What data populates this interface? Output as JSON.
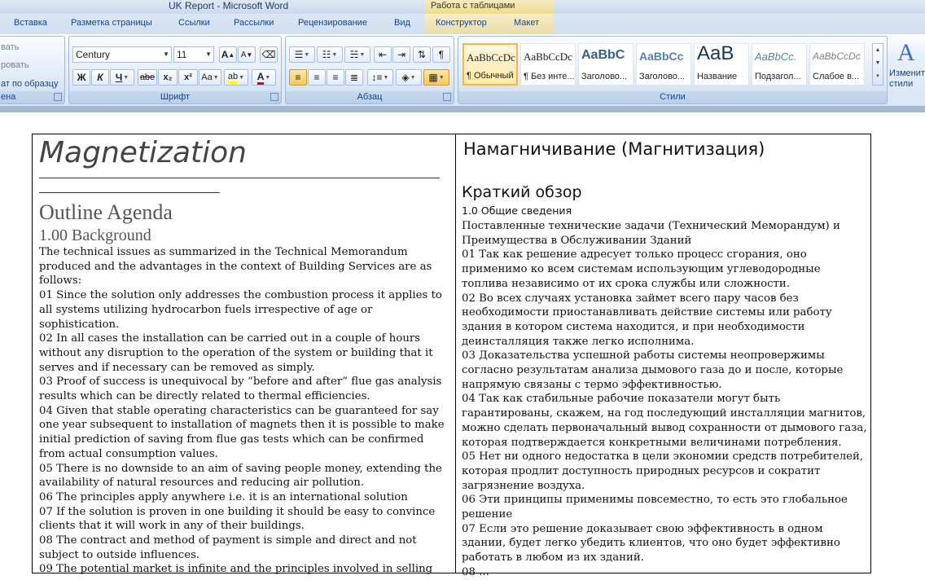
{
  "window": {
    "title": "UK Report - Microsoft Word",
    "context_tab_group": "Работа с таблицами"
  },
  "tabs": [
    "Вставка",
    "Разметка страницы",
    "Ссылки",
    "Рассылки",
    "Рецензирование",
    "Вид",
    "Конструктор",
    "Макет"
  ],
  "clipboard": {
    "cut": "вать",
    "copy": "ровать",
    "format_painter": "ат по образцу",
    "label": "ена"
  },
  "font": {
    "name": "Century",
    "size": "11",
    "group_label": "Шрифт",
    "bold": "Ж",
    "italic": "К",
    "underline": "Ч",
    "strike": "abe",
    "subscript": "x₂",
    "superscript": "x²",
    "change_case": "Aa",
    "grow": "A",
    "shrink": "A"
  },
  "paragraph": {
    "group_label": "Абзац"
  },
  "styles": {
    "group_label": "Стили",
    "items": [
      {
        "sample": "AaBbCcDc",
        "name": "¶ Обычный",
        "selected": true
      },
      {
        "sample": "AaBbCcDc",
        "name": "¶ Без инте..."
      },
      {
        "sample": "AaBbC",
        "name": "Заголово..."
      },
      {
        "sample": "AaBbCc",
        "name": "Заголово..."
      },
      {
        "sample": "AaB",
        "name": "Название"
      },
      {
        "sample": "AaBbCc.",
        "name": "Подзагол..."
      },
      {
        "sample": "AaBbCcDc",
        "name": "Слабое в..."
      }
    ],
    "change_styles": "Изменит стили"
  },
  "doc": {
    "en": {
      "title": "Magnetization",
      "heading": "Outline Agenda",
      "subheading": "1.00 Background",
      "lines": [
        "The technical issues as summarized in the Technical Memorandum",
        "produced and the advantages in the context of Building Services are as",
        "follows:",
        "01 Since the solution only addresses the combustion process it applies to",
        "all systems utilizing hydrocarbon fuels irrespective of age or",
        "sophistication.",
        "02 In all cases the installation can be carried out in a couple of hours",
        "without any disruption to the operation of the system or building that it",
        "serves and if necessary can be removed as simply.",
        "03 Proof of success is unequivocal by “before and after” flue gas analysis",
        "results which can be directly related to thermal efficiencies.",
        "04 Given that stable operating characteristics can be guaranteed for say",
        "one year subsequent to installation of magnets then it is possible to make",
        "initial prediction of saving from flue gas tests which can be confirmed",
        "from actual consumption values.",
        "05 There is no downside to an aim of saving people money, extending the",
        "availability of natural resources and reducing air pollution.",
        "06 The principles apply anywhere i.e. it is an international solution",
        "07 If the solution is proven in one building it should be easy to convince",
        "clients that it will work in any of their buildings.",
        "08 The contract and method of payment is simple and direct and not",
        "subject to outside influences.",
        "09 The potential market is infinite and the principles involved in selling"
      ]
    },
    "ru": {
      "title": "Намагничивание (Магнитизация)",
      "heading": "Краткий обзор",
      "subheading": "1.0    Общие сведения",
      "lines": [
        "Поставленные технические задачи (Технический Меморандум) и",
        "Преимущества в Обслуживании Зданий",
        "01 Так как решение адресует только процесс сгорания, оно",
        "применимо ко всем системам использующим углеводородные",
        "топлива независимо от их срока службы или сложности.",
        "02 Во всех случаях установка займет всего пару часов без",
        "необходимости приостанавливать действие системы или работу",
        "здания в котором система находится, и при необходимости",
        "деинсталляция также легко исполнима.",
        "03 Доказательства успешной работы системы неопровержимы",
        "согласно результатам анализа дымового газа до и после, которые",
        "напрямую связаны с термо эффективностью.",
        "04 Так как стабильные рабочие показатели могут быть",
        "гарантированы, скажем, на год последующий инсталляции магнитов,",
        "можно сделать первоначальный вывод сохранности от дымового газа,",
        "которая подтверждается конкретными величинами потребления.",
        "05 Нет ни одного недостатка в цели экономии средств потребителей,",
        "которая продлит доступность природных ресурсов и сократит",
        "загрязнение воздуха.",
        "06 Эти принципы применимы повсеместно, то есть это глобальное",
        "решение",
        "07 Если это решение доказывает свою эффективность в одном",
        "здании, будет легко убедить клиентов, что оно будет эффективно",
        "работать в любом из их зданий.",
        "08 ..."
      ]
    }
  }
}
